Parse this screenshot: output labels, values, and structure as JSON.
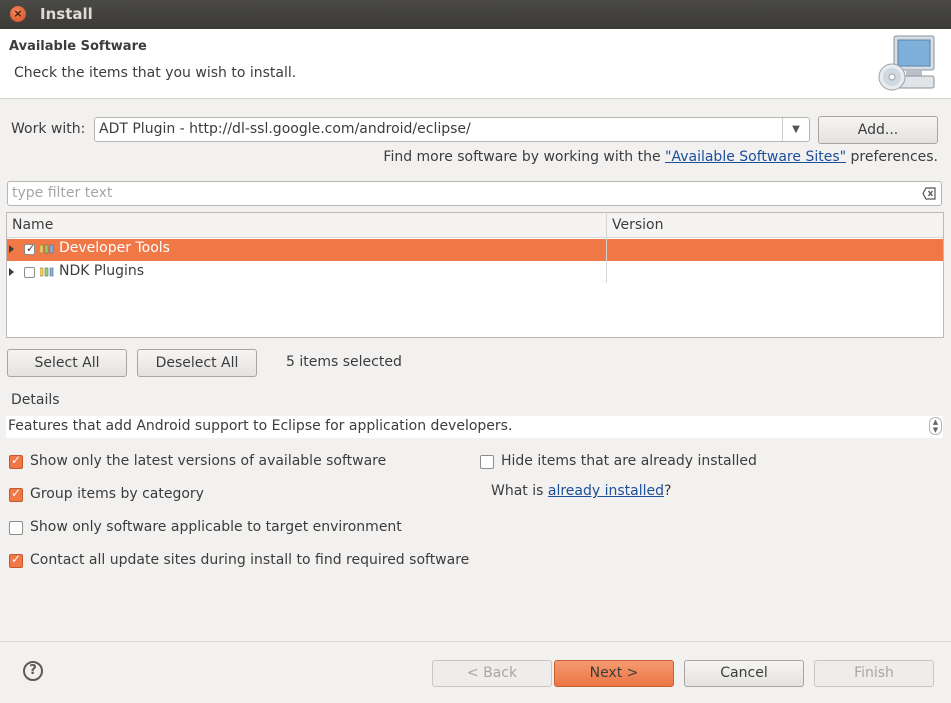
{
  "window": {
    "title": "Install",
    "close_glyph": "×"
  },
  "header": {
    "title": "Available Software",
    "description": "Check the items that you wish to install.",
    "icon": "monitor-cd-icon"
  },
  "work_with": {
    "label": "Work with:",
    "value": "ADT Plugin - http://dl-ssl.google.com/android/eclipse/",
    "add_label": "Add...",
    "find_more_prefix": "Find more software by working with the ",
    "find_more_link": "\"Available Software Sites\"",
    "find_more_suffix": " preferences."
  },
  "filter": {
    "placeholder": "type filter text"
  },
  "table": {
    "columns": [
      "Name",
      "Version"
    ],
    "rows": [
      {
        "name": "Developer Tools",
        "version": "",
        "checked": true,
        "selected": true
      },
      {
        "name": "NDK Plugins",
        "version": "",
        "checked": false,
        "selected": false
      }
    ]
  },
  "selection": {
    "select_all": "Select All",
    "deselect_all": "Deselect All",
    "status": "5 items selected"
  },
  "details": {
    "label": "Details",
    "text": "Features that add Android support to Eclipse for application developers."
  },
  "options": {
    "latest_versions": {
      "label": "Show only the latest versions of available software",
      "checked": true
    },
    "group_by_category": {
      "label": "Group items by category",
      "checked": true
    },
    "applicable_only": {
      "label": "Show only software applicable to target environment",
      "checked": false
    },
    "contact_update_sites": {
      "label": "Contact all update sites during install to find required software",
      "checked": true
    },
    "hide_installed": {
      "label": "Hide items that are already installed",
      "checked": false
    },
    "what_is_prefix": "What is ",
    "what_is_link": "already installed",
    "what_is_suffix": "?"
  },
  "footer": {
    "help": "?",
    "back": "< Back",
    "next": "Next >",
    "cancel": "Cancel",
    "finish": "Finish"
  },
  "colors": {
    "accent": "#f07746",
    "link": "#1b4f9c",
    "titlebar": "#3c3b37"
  }
}
